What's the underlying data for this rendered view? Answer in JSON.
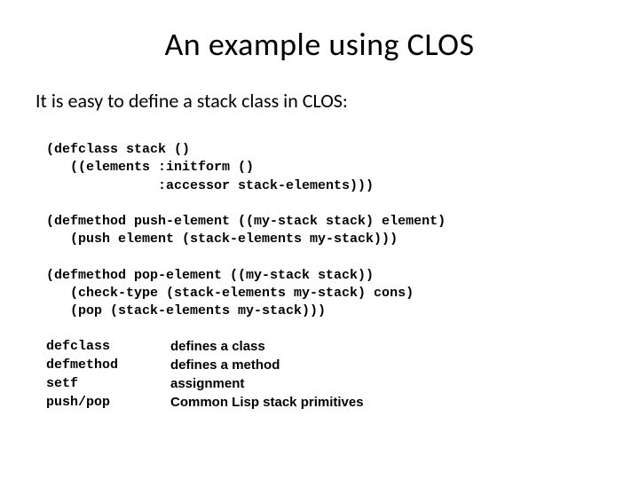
{
  "title": "An example using CLOS",
  "subtitle": "It is easy to define a stack class in CLOS:",
  "code": "(defclass stack ()\n   ((elements :initform ()\n              :accessor stack-elements)))\n\n(defmethod push-element ((my-stack stack) element)\n   (push element (stack-elements my-stack)))\n\n(defmethod pop-element ((my-stack stack))\n   (check-type (stack-elements my-stack) cons)\n   (pop (stack-elements my-stack)))",
  "definitions": {
    "terms": "defclass\ndefmethod\nsetf\npush/pop",
    "meanings": "defines a class\ndefines a method\nassignment\nCommon Lisp stack primitives"
  }
}
